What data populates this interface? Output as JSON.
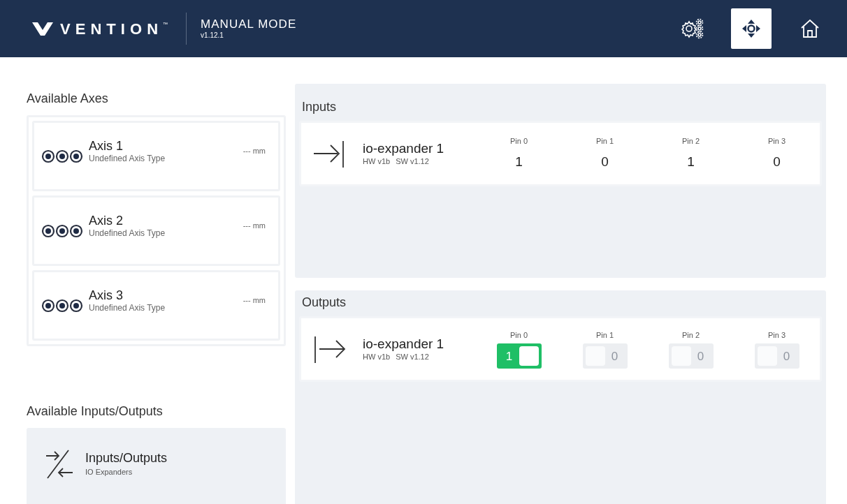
{
  "header": {
    "brand": "VENTION",
    "brand_mark": "™",
    "title": "MANUAL MODE",
    "version": "v1.12.1",
    "nav": [
      {
        "kind": "settings",
        "selected": false
      },
      {
        "kind": "jog",
        "selected": true
      },
      {
        "kind": "home",
        "selected": false
      }
    ]
  },
  "axes": {
    "heading": "Available Axes",
    "items": [
      {
        "name": "Axis 1",
        "type": "Undefined Axis Type",
        "reading": "--- mm"
      },
      {
        "name": "Axis 2",
        "type": "Undefined Axis Type",
        "reading": "--- mm"
      },
      {
        "name": "Axis 3",
        "type": "Undefined Axis Type",
        "reading": "--- mm"
      }
    ]
  },
  "io": {
    "heading": "Available Inputs/Outputs",
    "items": [
      {
        "name": "Inputs/Outputs",
        "subtitle": "IO Expanders"
      }
    ]
  },
  "inputs": {
    "heading": "Inputs",
    "devices": [
      {
        "name": "io-expander 1",
        "hw": "HW v1b",
        "sw": "SW v1.12",
        "pins": [
          {
            "label": "Pin 0",
            "value": "1"
          },
          {
            "label": "Pin 1",
            "value": "0"
          },
          {
            "label": "Pin 2",
            "value": "1"
          },
          {
            "label": "Pin 3",
            "value": "0"
          }
        ]
      }
    ]
  },
  "outputs": {
    "heading": "Outputs",
    "devices": [
      {
        "name": "io-expander 1",
        "hw": "HW v1b",
        "sw": "SW v1.12",
        "pins": [
          {
            "label": "Pin 0",
            "value": "1",
            "on": true
          },
          {
            "label": "Pin 1",
            "value": "0",
            "on": false
          },
          {
            "label": "Pin 2",
            "value": "0",
            "on": false
          },
          {
            "label": "Pin 3",
            "value": "0",
            "on": false
          }
        ]
      }
    ]
  }
}
